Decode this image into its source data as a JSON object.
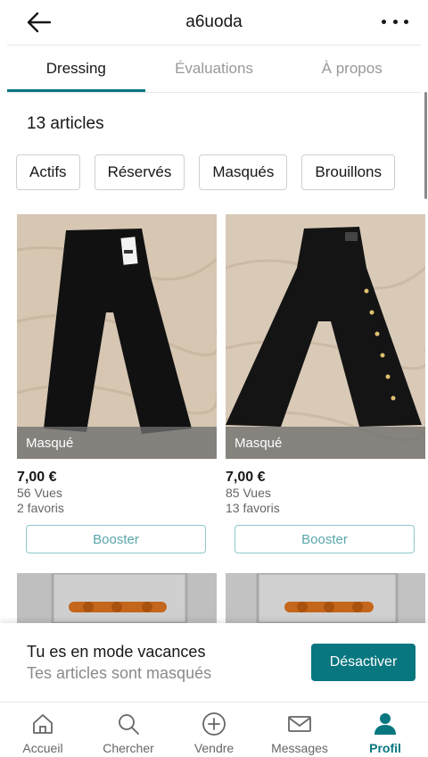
{
  "header": {
    "title": "a6uoda"
  },
  "tabs": [
    {
      "label": "Dressing",
      "active": true
    },
    {
      "label": "Évaluations",
      "active": false
    },
    {
      "label": "À propos",
      "active": false
    }
  ],
  "item_count": "13 articles",
  "filters": [
    "Actifs",
    "Réservés",
    "Masqués",
    "Brouillons"
  ],
  "items": [
    {
      "status": "Masqué",
      "price": "7,00 €",
      "views": "56 Vues",
      "favorites": "2 favoris",
      "boost_label": "Booster"
    },
    {
      "status": "Masqué",
      "price": "7,00 €",
      "views": "85 Vues",
      "favorites": "13 favoris",
      "boost_label": "Booster"
    }
  ],
  "vacation": {
    "title": "Tu es en mode vacances",
    "subtitle": "Tes articles sont masqués",
    "button": "Désactiver"
  },
  "bottom_nav": [
    {
      "label": "Accueil",
      "icon": "home-icon",
      "active": false
    },
    {
      "label": "Chercher",
      "icon": "search-icon",
      "active": false
    },
    {
      "label": "Vendre",
      "icon": "plus-circle-icon",
      "active": false
    },
    {
      "label": "Messages",
      "icon": "mail-icon",
      "active": false
    },
    {
      "label": "Profil",
      "icon": "profile-icon",
      "active": true
    }
  ],
  "colors": {
    "accent": "#09777f",
    "text": "#171717",
    "muted": "#999999",
    "overlay": "#6e6e6e"
  }
}
